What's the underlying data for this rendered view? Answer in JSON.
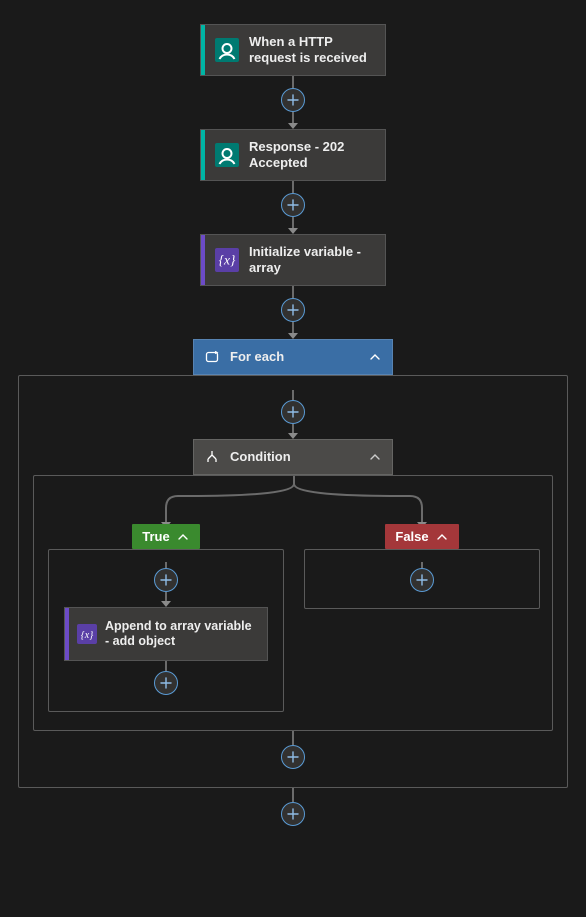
{
  "nodes": {
    "trigger": {
      "label": "When a HTTP request is received"
    },
    "response": {
      "label": "Response - 202 Accepted"
    },
    "initvar": {
      "label": "Initialize variable - array"
    },
    "foreach": {
      "label": "For each"
    },
    "condition": {
      "label": "Condition"
    },
    "append": {
      "label": "Append to array variable - add object"
    }
  },
  "branches": {
    "true": "True",
    "false": "False"
  }
}
